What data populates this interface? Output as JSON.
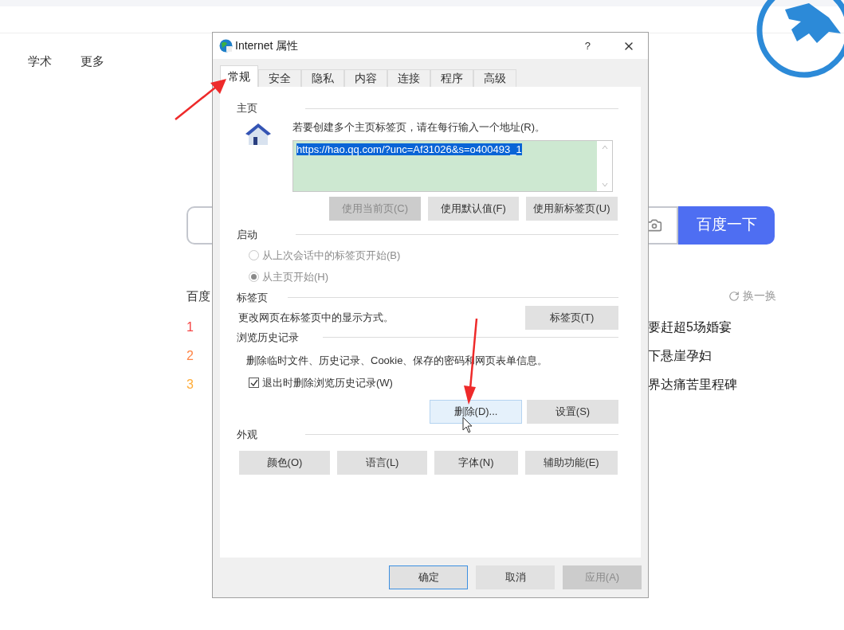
{
  "browser_page": {
    "nav": [
      {
        "label": "学术"
      },
      {
        "label": "更多"
      }
    ],
    "search_button": "百度一下",
    "hot_title": "百度",
    "refresh": "换一换",
    "hot_list": [
      {
        "rank": "1",
        "text": "要赶超5场婚宴",
        "color": "#f54545"
      },
      {
        "rank": "2",
        "text": "下悬崖孕妇",
        "color": "#ff8547"
      },
      {
        "rank": "3",
        "text": "界达痛苦里程碑",
        "color": "#ffac38"
      }
    ]
  },
  "dialog": {
    "title": "Internet 属性",
    "help": "?",
    "tabs": [
      {
        "label": "常规",
        "selected": true
      },
      {
        "label": "安全",
        "selected": false
      },
      {
        "label": "隐私",
        "selected": false
      },
      {
        "label": "内容",
        "selected": false
      },
      {
        "label": "连接",
        "selected": false
      },
      {
        "label": "程序",
        "selected": false
      },
      {
        "label": "高级",
        "selected": false
      }
    ],
    "homepage": {
      "heading": "主页",
      "hint": "若要创建多个主页标签页，请在每行输入一个地址(R)。",
      "url": "https://hao.qq.com/?unc=Af31026&s=o400493_1",
      "buttons": [
        {
          "label": "使用当前页(C)",
          "disabled": true
        },
        {
          "label": "使用默认值(F)",
          "disabled": false
        },
        {
          "label": "使用新标签页(U)",
          "disabled": false
        }
      ]
    },
    "startup": {
      "heading": "启动",
      "options": [
        {
          "label": "从上次会话中的标签页开始(B)",
          "selected": false,
          "disabled": true
        },
        {
          "label": "从主页开始(H)",
          "selected": true,
          "disabled": true
        }
      ]
    },
    "tabs_section": {
      "heading": "标签页",
      "text": "更改网页在标签页中的显示方式。",
      "button": "标签页(T)"
    },
    "history": {
      "heading": "浏览历史记录",
      "text": "删除临时文件、历史记录、Cookie、保存的密码和网页表单信息。",
      "checkbox": {
        "label": "退出时删除浏览历史记录(W)",
        "checked": true
      },
      "buttons": [
        {
          "label": "删除(D)...",
          "hovered": true
        },
        {
          "label": "设置(S)",
          "hovered": false
        }
      ]
    },
    "appearance": {
      "heading": "外观",
      "buttons": [
        {
          "label": "颜色(O)"
        },
        {
          "label": "语言(L)"
        },
        {
          "label": "字体(N)"
        },
        {
          "label": "辅助功能(E)"
        }
      ]
    },
    "footer": [
      {
        "label": "确定",
        "focused": true,
        "disabled": false
      },
      {
        "label": "取消",
        "focused": false,
        "disabled": false
      },
      {
        "label": "应用(A)",
        "focused": false,
        "disabled": true
      }
    ]
  }
}
